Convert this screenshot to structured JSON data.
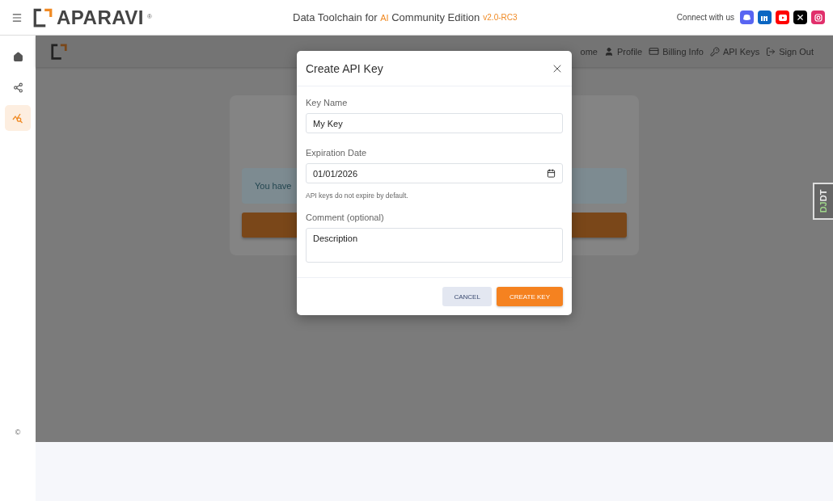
{
  "header": {
    "brand": "APARAVI",
    "brand_mark": "®",
    "title_start": "Data Toolchain for",
    "title_highlight": "AI",
    "title_end": "Community Edition",
    "version": "v2.0-RC3",
    "connect_label": "Connect with us",
    "socials": [
      {
        "kind": "discord",
        "color": "#5865f2"
      },
      {
        "kind": "linkedin",
        "color": "#0a66c2"
      },
      {
        "kind": "youtube",
        "color": "#ff0000"
      },
      {
        "kind": "x",
        "color": "#000000"
      },
      {
        "kind": "instagram",
        "color": "#e1306c"
      }
    ]
  },
  "sidebar": {
    "items": [
      {
        "kind": "home",
        "selected": false
      },
      {
        "kind": "share",
        "selected": false
      },
      {
        "kind": "analytics",
        "selected": true
      }
    ],
    "footer": "©"
  },
  "nav": {
    "links": [
      {
        "label": "ome",
        "kind": "none"
      },
      {
        "label": "Profile",
        "kind": "user"
      },
      {
        "label": "Billing Info",
        "kind": "card"
      },
      {
        "label": "API Keys",
        "kind": "key"
      },
      {
        "label": "Sign Out",
        "kind": "signout"
      }
    ]
  },
  "card": {
    "alert": "You have"
  },
  "dialog": {
    "title": "Create API Key",
    "fields": [
      {
        "kind": "text",
        "label": "Key Name",
        "value": "My Key"
      },
      {
        "kind": "date",
        "label": "Expiration Date",
        "value": "01/01/2026",
        "help": "API keys do not expire by default."
      },
      {
        "kind": "textarea",
        "label": "Comment (optional)",
        "value": "Description"
      }
    ],
    "buttons": [
      {
        "label": "CANCEL",
        "kind": "secondary"
      },
      {
        "label": "CREATE KEY",
        "kind": "primary"
      }
    ]
  },
  "debug_toolbar": {
    "label_start": "DJ",
    "label_end": "DT"
  }
}
